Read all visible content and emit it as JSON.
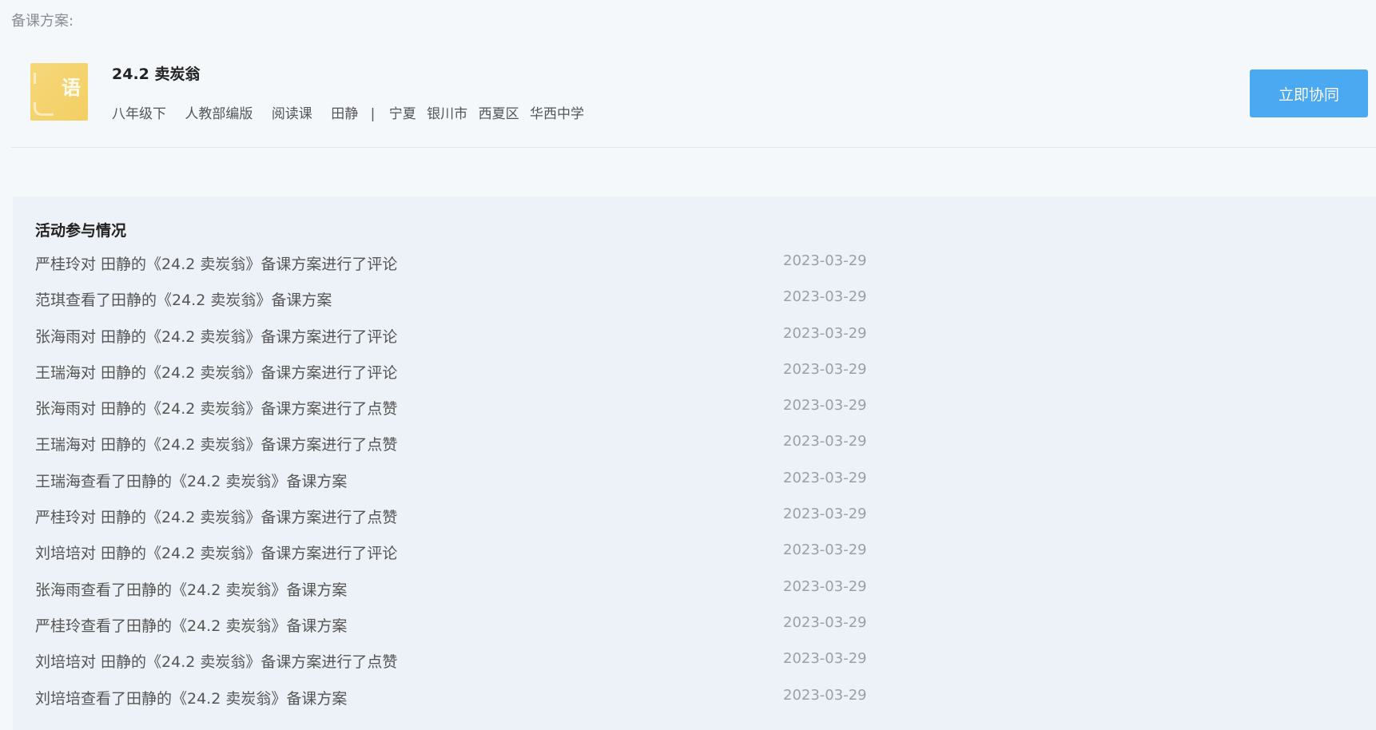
{
  "section_label": "备课方案:",
  "plan": {
    "thumb_char": "语",
    "title": "24.2 卖炭翁",
    "meta": {
      "grade": "八年级下",
      "edition": "人教部编版",
      "lesson_type": "阅读课",
      "teacher": "田静",
      "separator": "|",
      "province": "宁夏",
      "city": "银川市",
      "district": "西夏区",
      "school": "华西中学"
    },
    "collab_button_label": "立即协同"
  },
  "colors": {
    "accent": "#4aa9f0",
    "thumb": "#f3cf63",
    "panel_bg": "#edf2f8"
  },
  "activity": {
    "title": "活动参与情况",
    "items": [
      {
        "text": "严桂玲对 田静的《24.2 卖炭翁》备课方案进行了评论",
        "date": "2023-03-29"
      },
      {
        "text": "范琪查看了田静的《24.2 卖炭翁》备课方案",
        "date": "2023-03-29"
      },
      {
        "text": "张海雨对 田静的《24.2 卖炭翁》备课方案进行了评论",
        "date": "2023-03-29"
      },
      {
        "text": "王瑞海对 田静的《24.2 卖炭翁》备课方案进行了评论",
        "date": "2023-03-29"
      },
      {
        "text": "张海雨对 田静的《24.2 卖炭翁》备课方案进行了点赞",
        "date": "2023-03-29"
      },
      {
        "text": "王瑞海对 田静的《24.2 卖炭翁》备课方案进行了点赞",
        "date": "2023-03-29"
      },
      {
        "text": "王瑞海查看了田静的《24.2 卖炭翁》备课方案",
        "date": "2023-03-29"
      },
      {
        "text": "严桂玲对 田静的《24.2 卖炭翁》备课方案进行了点赞",
        "date": "2023-03-29"
      },
      {
        "text": "刘培培对 田静的《24.2 卖炭翁》备课方案进行了评论",
        "date": "2023-03-29"
      },
      {
        "text": "张海雨查看了田静的《24.2 卖炭翁》备课方案",
        "date": "2023-03-29"
      },
      {
        "text": "严桂玲查看了田静的《24.2 卖炭翁》备课方案",
        "date": "2023-03-29"
      },
      {
        "text": "刘培培对 田静的《24.2 卖炭翁》备课方案进行了点赞",
        "date": "2023-03-29"
      },
      {
        "text": "刘培培查看了田静的《24.2 卖炭翁》备课方案",
        "date": "2023-03-29"
      }
    ]
  }
}
